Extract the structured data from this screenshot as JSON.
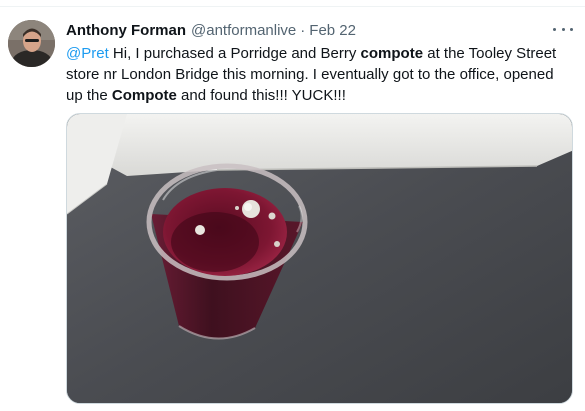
{
  "tweet": {
    "author_name": "Anthony Forman",
    "handle": "@antformanlive",
    "separator": "·",
    "date": "Feb 22",
    "text": {
      "mention": "@Pret",
      "part1": " Hi, I purchased a Porridge and Berry ",
      "bold1": "compote",
      "part2": " at the Tooley Street store nr London Bridge this morning. I eventually got to the office, opened up the ",
      "bold2": "Compote",
      "part3": " and found this!!! YUCK!!!"
    }
  },
  "icons": {
    "more": "more-horizontal-icon"
  },
  "colors": {
    "link": "#1d9bf0",
    "text": "#0f1419",
    "secondary": "#536471",
    "border": "#cfd9de"
  }
}
